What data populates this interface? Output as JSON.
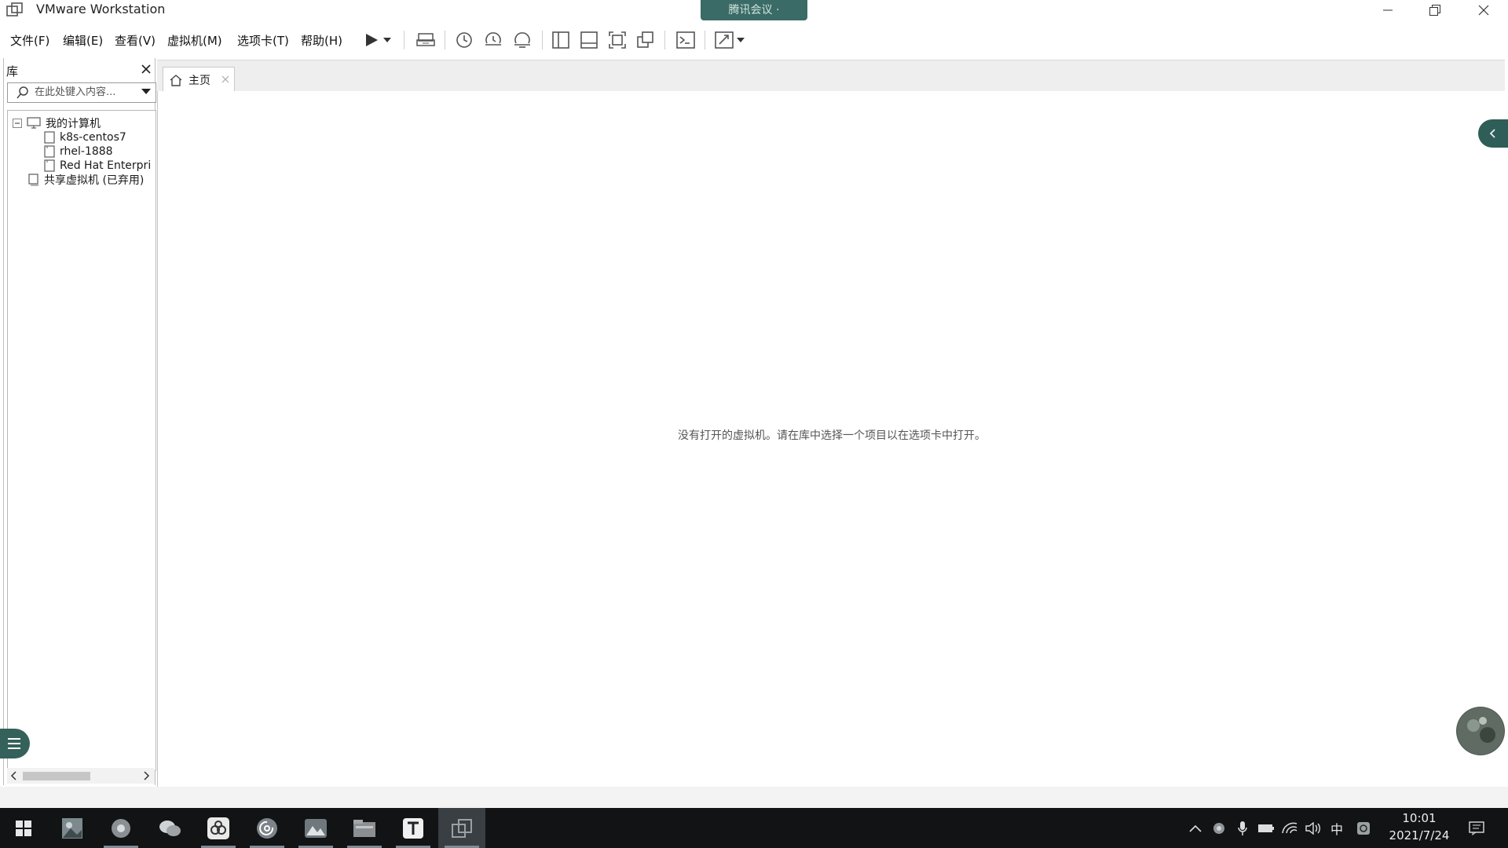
{
  "window": {
    "title": "VMware Workstation",
    "meeting_pill": "腾讯会议 ·"
  },
  "menu": {
    "items": [
      "文件(F)",
      "编辑(E)",
      "查看(V)",
      "虚拟机(M)",
      "选项卡(T)",
      "帮助(H)"
    ]
  },
  "library": {
    "title": "库",
    "search_placeholder": "在此处键入内容...",
    "tree": {
      "root": "我的计算机",
      "vms": [
        "k8s-centos7",
        "rhel-1888",
        "Red Hat Enterpri"
      ],
      "shared": "共享虚拟机 (已弃用)"
    }
  },
  "tabs": [
    {
      "label": "主页",
      "icon": "home-icon"
    }
  ],
  "main": {
    "empty_message": "没有打开的虚拟机。请在库中选择一个项目以在选项卡中打开。"
  },
  "taskbar": {
    "apps": [
      "start-icon",
      "photo-app-icon",
      "browser-icon",
      "wechat-icon",
      "baidu-netdisk-icon",
      "netease-music-icon",
      "gallery-app-icon",
      "file-explorer-icon",
      "typora-icon",
      "vmware-icon"
    ],
    "ime": "中",
    "time": "10:01",
    "date": "2021/7/24"
  },
  "colors": {
    "accent_teal": "#2f5d58",
    "taskbar_bg": "#111315"
  }
}
